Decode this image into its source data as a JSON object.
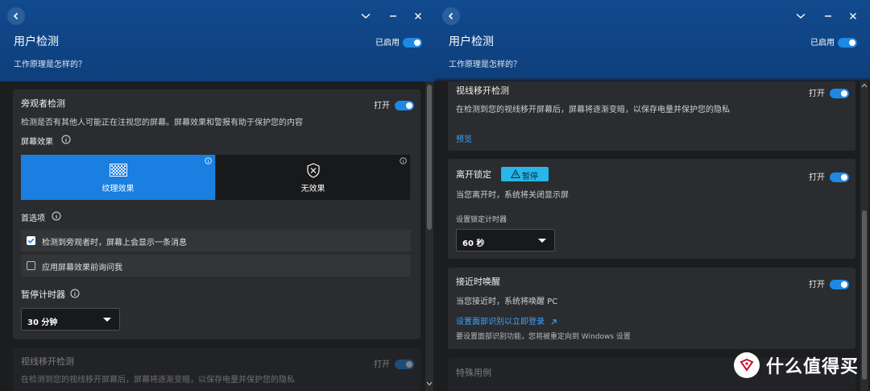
{
  "left": {
    "header": {
      "title": "用户检测",
      "subtitle": "工作原理是怎样的？",
      "enabled_label": "已启用"
    },
    "onlooker": {
      "title": "旁观者检测",
      "toggle_label": "打开",
      "description": "检测是否有其他人可能正在注视您的屏幕。屏幕效果和警报有助于保护您的内容",
      "screen_effect_label": "屏幕效果",
      "effects": [
        {
          "label": "纹理效果",
          "selected": true
        },
        {
          "label": "无效果",
          "selected": false
        }
      ],
      "preferences_label": "首选项",
      "preferences": [
        {
          "label": "检测到旁观者时，屏幕上会显示一条消息",
          "checked": true
        },
        {
          "label": "应用屏幕效果前询问我",
          "checked": false
        }
      ],
      "pause_timer_label": "暂停计时器",
      "pause_timer_value": "30 分钟"
    },
    "gaze_preview": {
      "title": "视线移开检测",
      "toggle_label": "打开",
      "description": "在检测到您的视线移开屏幕后，屏幕将逐渐变暗，以保存电量并保护您的隐私"
    },
    "scroll_fraction": 0.35
  },
  "right": {
    "header": {
      "title": "用户检测",
      "subtitle": "工作原理是怎样的？",
      "enabled_label": "已启用"
    },
    "gaze": {
      "title": "视线移开检测",
      "toggle_label": "打开",
      "description": "在检测到您的视线移开屏幕后，屏幕将逐渐变暗，以保存电量并保护您的隐私",
      "preview_link": "预览"
    },
    "away_lock": {
      "title": "离开锁定",
      "badge": "暂停",
      "toggle_label": "打开",
      "description": "当您离开时，系统将关闭显示屏",
      "timer_label": "设置锁定计时器",
      "timer_value": "60 秒"
    },
    "wake_on_approach": {
      "title": "接近时唤醒",
      "toggle_label": "打开",
      "description": "当您接近时，系统将唤醒 PC",
      "face_link": "设置面部识别以立即登录",
      "face_note": "要设置面部识别功能，您将被重定向到 Windows 设置"
    },
    "special_cases": "特殊用例"
  },
  "watermark": "什么值得买",
  "colors": {
    "header": "#114a8e",
    "accent": "#1e88e5",
    "card": "#2a2c2f",
    "background": "#1c1d1f",
    "link": "#3aa3ff"
  }
}
